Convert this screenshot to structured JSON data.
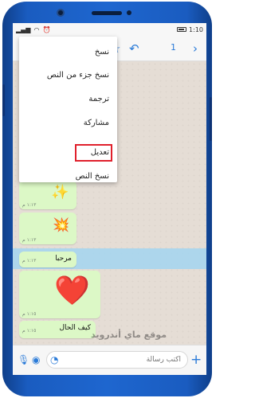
{
  "status_bar": {
    "time": "1:10",
    "right_text": "",
    "left_text": ""
  },
  "action_bar": {
    "selected_count": "1",
    "star_icon": "star-icon",
    "reply_icon": "reply-icon",
    "forward_icon": "forward-icon",
    "back_icon": "back-chevron-icon"
  },
  "context_menu": {
    "items": [
      "نسخ",
      "نسخ جزء من النص",
      "ترجمة",
      "مشاركة",
      "تعديل",
      "نسخ النص"
    ],
    "highlighted": "تعديل",
    "highlight_color": "#e0202c"
  },
  "messages": [
    {
      "emoji": "✨",
      "time": "١:١٣ م"
    },
    {
      "emoji": "💥",
      "time": "١:١٣ م"
    },
    {
      "text": "مرحبا",
      "time": "١:١٣ م"
    },
    {
      "emoji": "❤️",
      "time": "١:١٥ م"
    },
    {
      "text": "كيف الحال",
      "time": "١:١٥ م"
    }
  ],
  "watermark": "موقع ماي أندرويد",
  "input": {
    "placeholder": "اكتب رسالة"
  },
  "colors": {
    "accent": "#2b7bd8",
    "bubble": "#dcf8c6",
    "selection": "#a6d5ee",
    "phone_body": "#1e66cf"
  }
}
